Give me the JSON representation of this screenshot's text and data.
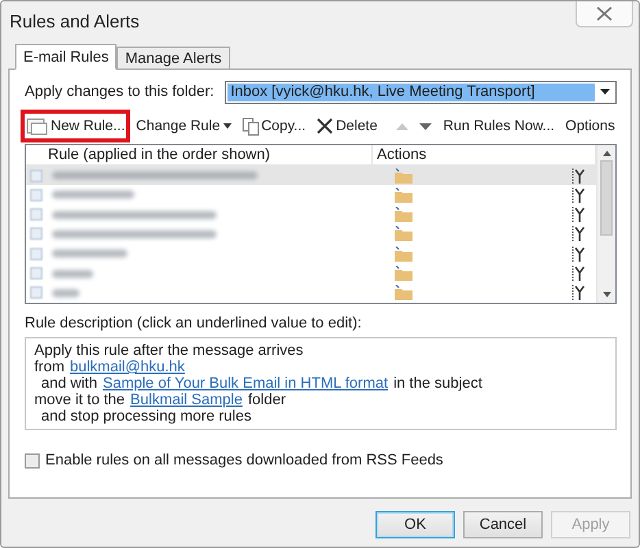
{
  "window": {
    "title": "Rules and Alerts"
  },
  "tabs": [
    {
      "label": "E-mail Rules",
      "selected": true
    },
    {
      "label": "Manage Alerts",
      "selected": false
    }
  ],
  "folder": {
    "label": "Apply changes to this folder:",
    "value": "Inbox [vyick@hku.hk, Live Meeting Transport]"
  },
  "toolbar": [
    {
      "kind": "new",
      "label": "New Rule...",
      "highlighted": true
    },
    {
      "kind": "change",
      "label": "Change Rule",
      "highlighted": false
    },
    {
      "kind": "copy",
      "label": "Copy...",
      "highlighted": false
    },
    {
      "kind": "delete",
      "label": "Delete",
      "highlighted": false
    },
    {
      "kind": "up",
      "highlighted": false
    },
    {
      "kind": "down",
      "highlighted": false
    },
    {
      "kind": "run",
      "label": "Run Rules Now...",
      "highlighted": false
    },
    {
      "kind": "options",
      "label": "Options",
      "highlighted": false
    }
  ],
  "rules_table": {
    "columns": [
      "Rule (applied in the order shown)",
      "Actions"
    ],
    "rows": [
      {
        "selected": true
      },
      {
        "selected": false
      },
      {
        "selected": false
      },
      {
        "selected": false
      },
      {
        "selected": false
      },
      {
        "selected": false
      },
      {
        "selected": false
      }
    ]
  },
  "description": {
    "label": "Rule description (click an underlined value to edit):",
    "lines": [
      {
        "indented": false,
        "parts": [
          {
            "text": "Apply this rule after the message arrives",
            "link": false
          }
        ]
      },
      {
        "indented": false,
        "parts": [
          {
            "text": "from",
            "link": false
          },
          {
            "text": "bulkmail@hku.hk",
            "link": true
          }
        ]
      },
      {
        "indented": true,
        "parts": [
          {
            "text": "and with",
            "link": false
          },
          {
            "text": "Sample of Your Bulk Email in HTML format",
            "link": true
          },
          {
            "text": "in the subject",
            "link": false
          }
        ]
      },
      {
        "indented": false,
        "parts": [
          {
            "text": "move it to the",
            "link": false
          },
          {
            "text": "Bulkmail Sample",
            "link": true
          },
          {
            "text": "folder",
            "link": false
          }
        ]
      },
      {
        "indented": true,
        "parts": [
          {
            "text": "and stop processing more rules",
            "link": false
          }
        ]
      }
    ]
  },
  "rss": {
    "label": "Enable rules on all messages downloaded from RSS Feeds",
    "checked": false
  },
  "buttons": [
    {
      "label": "OK",
      "kind": "default",
      "disabled": false
    },
    {
      "label": "Cancel",
      "kind": "normal",
      "disabled": false
    },
    {
      "label": "Apply",
      "kind": "normal",
      "disabled": true
    }
  ]
}
